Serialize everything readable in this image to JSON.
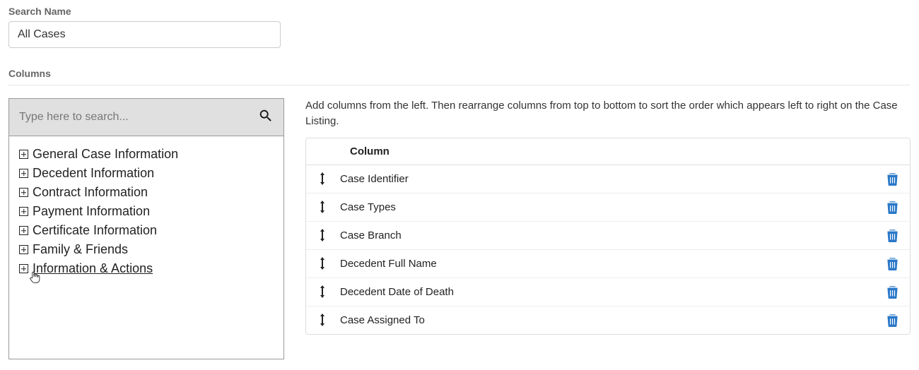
{
  "search_name": {
    "label": "Search Name",
    "value": "All Cases"
  },
  "columns_section": {
    "label": "Columns",
    "search_placeholder": "Type here to search...",
    "tree": [
      {
        "label": "General Case Information"
      },
      {
        "label": "Decedent Information"
      },
      {
        "label": "Contract Information"
      },
      {
        "label": "Payment Information"
      },
      {
        "label": "Certificate Information"
      },
      {
        "label": "Family & Friends"
      },
      {
        "label": "Information & Actions"
      }
    ],
    "help_text": "Add columns from the left. Then rearrange columns from top to bottom to sort the order which appears left to right on the Case Listing.",
    "table_header": "Column",
    "rows": [
      {
        "name": "Case Identifier"
      },
      {
        "name": "Case Types"
      },
      {
        "name": "Case Branch"
      },
      {
        "name": "Decedent Full Name"
      },
      {
        "name": "Decedent Date of Death"
      },
      {
        "name": "Case Assigned To"
      }
    ]
  }
}
